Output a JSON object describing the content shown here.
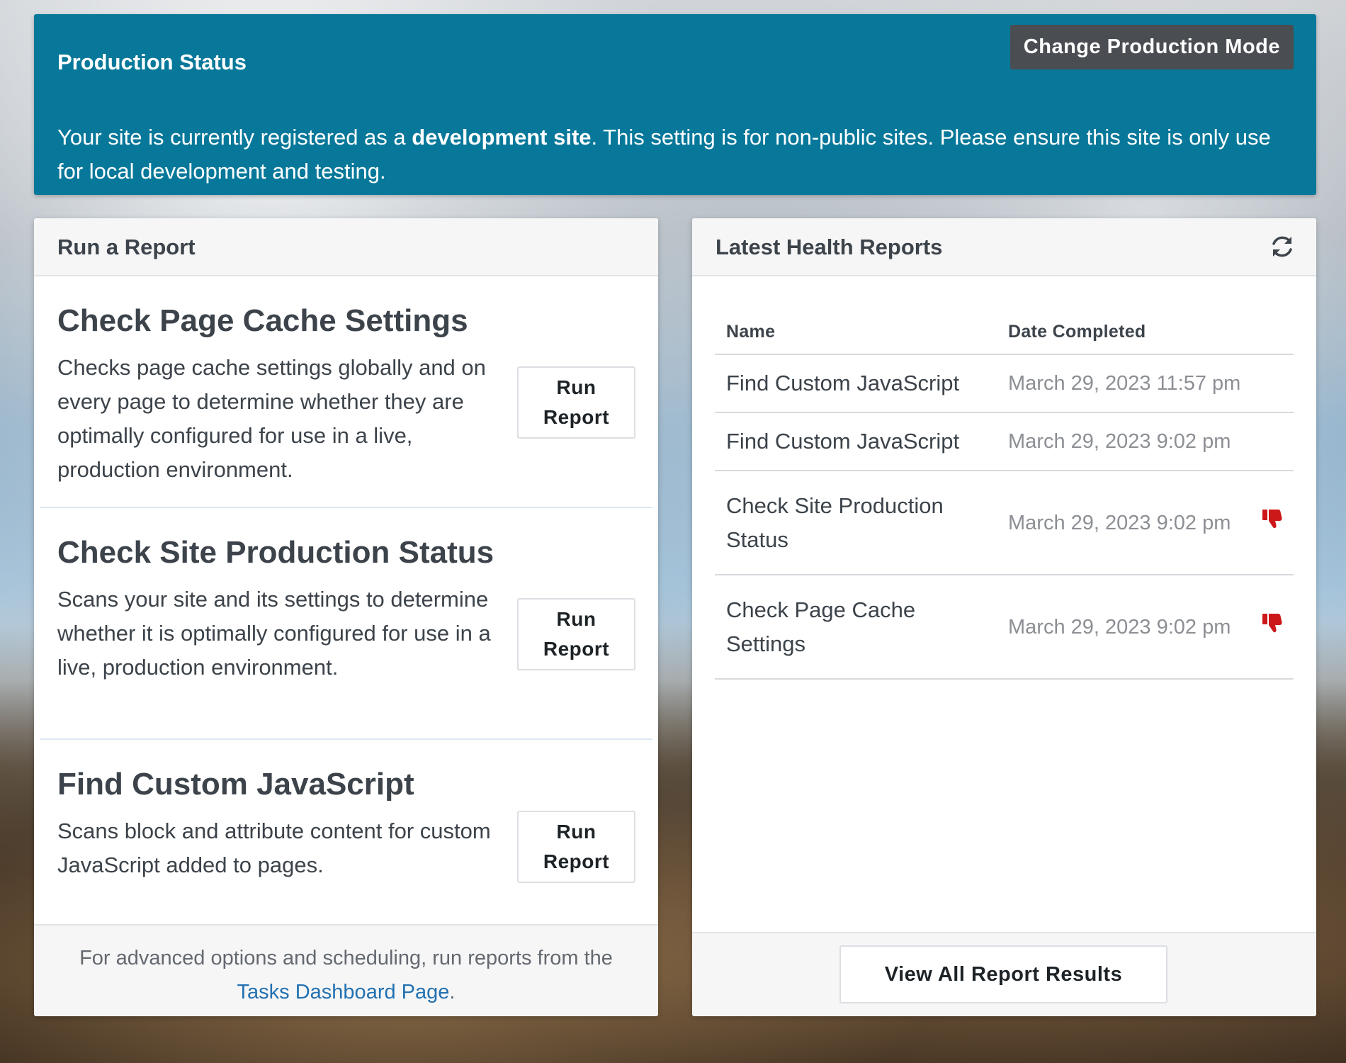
{
  "banner": {
    "title": "Production Status",
    "button_label": "Change Production Mode",
    "text_before": "Your site is currently registered as a ",
    "text_bold": "development site",
    "text_after": ". This setting is for non-public sites. Please ensure this site is only use for local development and testing.",
    "background_color": "#07789a"
  },
  "run_report_panel": {
    "title": "Run a Report",
    "reports": [
      {
        "title": "Check Page Cache Settings",
        "description": "Checks page cache settings globally and on every page to determine whether they are optimally configured for use in a live, production environment.",
        "button_line1": "Run",
        "button_line2": "Report"
      },
      {
        "title": "Check Site Production Status",
        "description": "Scans your site and its settings to determine whether it is optimally configured for use in a live, production environment.",
        "button_line1": "Run",
        "button_line2": "Report"
      },
      {
        "title": "Find Custom JavaScript",
        "description": "Scans block and attribute content for custom JavaScript added to pages.",
        "button_line1": "Run",
        "button_line2": "Report"
      }
    ],
    "footer_text": "For advanced options and scheduling, run reports from the ",
    "footer_link": "Tasks Dashboard Page",
    "footer_end": "."
  },
  "health_panel": {
    "title": "Latest Health Reports",
    "refresh_icon": "refresh-icon",
    "columns": [
      "Name",
      "Date Completed"
    ],
    "rows": [
      {
        "name": "Find Custom JavaScript",
        "date": "March 29, 2023 11:57 pm",
        "status_icon": ""
      },
      {
        "name": "Find Custom JavaScript",
        "date": "March 29, 2023 9:02 pm",
        "status_icon": ""
      },
      {
        "name": "Check Site Production Status",
        "date": "March 29, 2023 9:02 pm",
        "status_icon": "thumbs-down-icon"
      },
      {
        "name": "Check Page Cache Settings",
        "date": "March 29, 2023 9:02 pm",
        "status_icon": "thumbs-down-icon"
      }
    ],
    "view_all_label": "View All Report Results",
    "thumbs_down_color": "#cc1818"
  }
}
